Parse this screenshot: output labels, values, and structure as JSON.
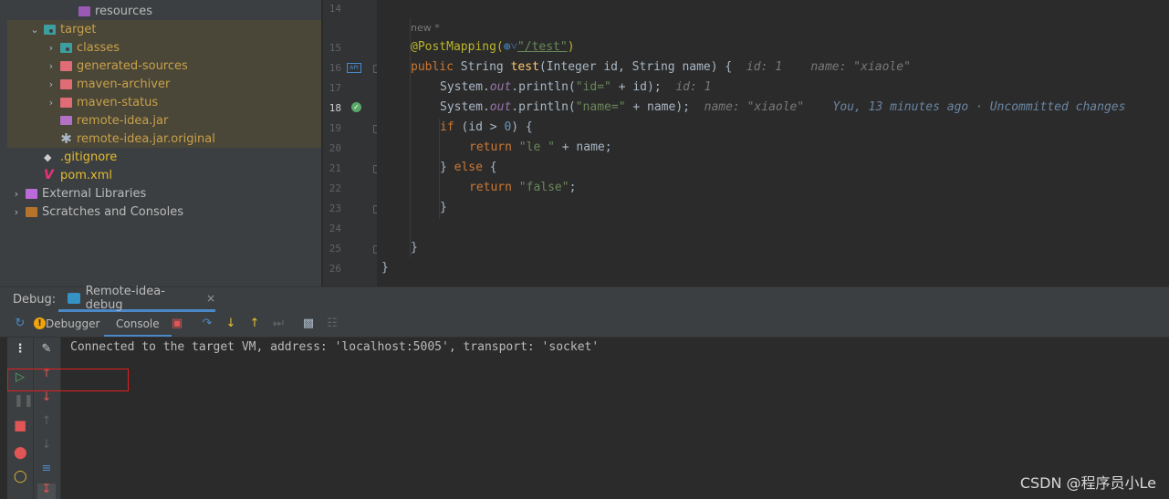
{
  "project_tree": {
    "items": [
      {
        "label": "resources",
        "icon": "resources-folder-icon"
      },
      {
        "label": "target",
        "icon": "excluded-folder-icon"
      },
      {
        "label": "classes",
        "icon": "classes-folder-icon"
      },
      {
        "label": "generated-sources",
        "icon": "folder-icon"
      },
      {
        "label": "maven-archiver",
        "icon": "folder-icon"
      },
      {
        "label": "maven-status",
        "icon": "folder-icon"
      },
      {
        "label": "remote-idea.jar",
        "icon": "jar-icon"
      },
      {
        "label": "remote-idea.jar.original",
        "icon": "file-icon"
      },
      {
        "label": ".gitignore",
        "icon": "gitignore-icon"
      },
      {
        "label": "pom.xml",
        "icon": "maven-icon"
      },
      {
        "label": "External Libraries",
        "icon": "libraries-icon"
      },
      {
        "label": "Scratches and Consoles",
        "icon": "scratches-icon"
      }
    ]
  },
  "editor": {
    "usage_hint": "new *",
    "current_line": 18,
    "line_numbers": [
      "14",
      "15",
      "16",
      "17",
      "18",
      "19",
      "20",
      "21",
      "22",
      "23",
      "24",
      "25",
      "26"
    ],
    "code": {
      "l15_annotation": "@PostMapping(",
      "l15_glob": "⊕˅",
      "l15_path": "\"/test\"",
      "l15_close": ")",
      "l16_kw": "public",
      "l16_type": " String ",
      "l16_method": "test",
      "l16_params": "(Integer id, String name) {",
      "l16_hint": "  id: 1    name: \"xiaole\"",
      "l17_sys": "System.",
      "l17_out": "out",
      "l17_call": ".println(",
      "l17_str": "\"id=\"",
      "l17_rest": " + id);",
      "l17_hint": "  id: 1",
      "l18_sys": "System.",
      "l18_out": "out",
      "l18_call": ".println(",
      "l18_str": "\"name=\"",
      "l18_rest": " + name);",
      "l18_hint": "  name: \"xiaole\"",
      "l18_blame": "    You, 13 minutes ago · Uncommitted changes",
      "l19_kw": "if",
      "l19_a": " (id > ",
      "l19_num": "0",
      "l19_b": ") {",
      "l20_kw": "return",
      "l20_str": " \"le \"",
      "l20_rest": " + name;",
      "l21_a": "} ",
      "l21_kw": "else",
      "l21_b": " {",
      "l22_kw": "return",
      "l22_str": " \"false\"",
      "l22_rest": ";",
      "l23": "}",
      "l25": "}",
      "l26": "}"
    }
  },
  "debug": {
    "label": "Debug:",
    "session_tab": "Remote-idea-debug",
    "close_glyph": "×",
    "tabs": {
      "debugger": "Debugger",
      "console": "Console"
    },
    "console_output": "Connected to the target VM, address: 'localhost:5005', transport: 'socket'"
  },
  "watermark": "CSDN @程序员小Le",
  "colors": {
    "accent": "#4a88c7",
    "highlight_box": "#e02020",
    "current_line": "#2d5b8a"
  }
}
